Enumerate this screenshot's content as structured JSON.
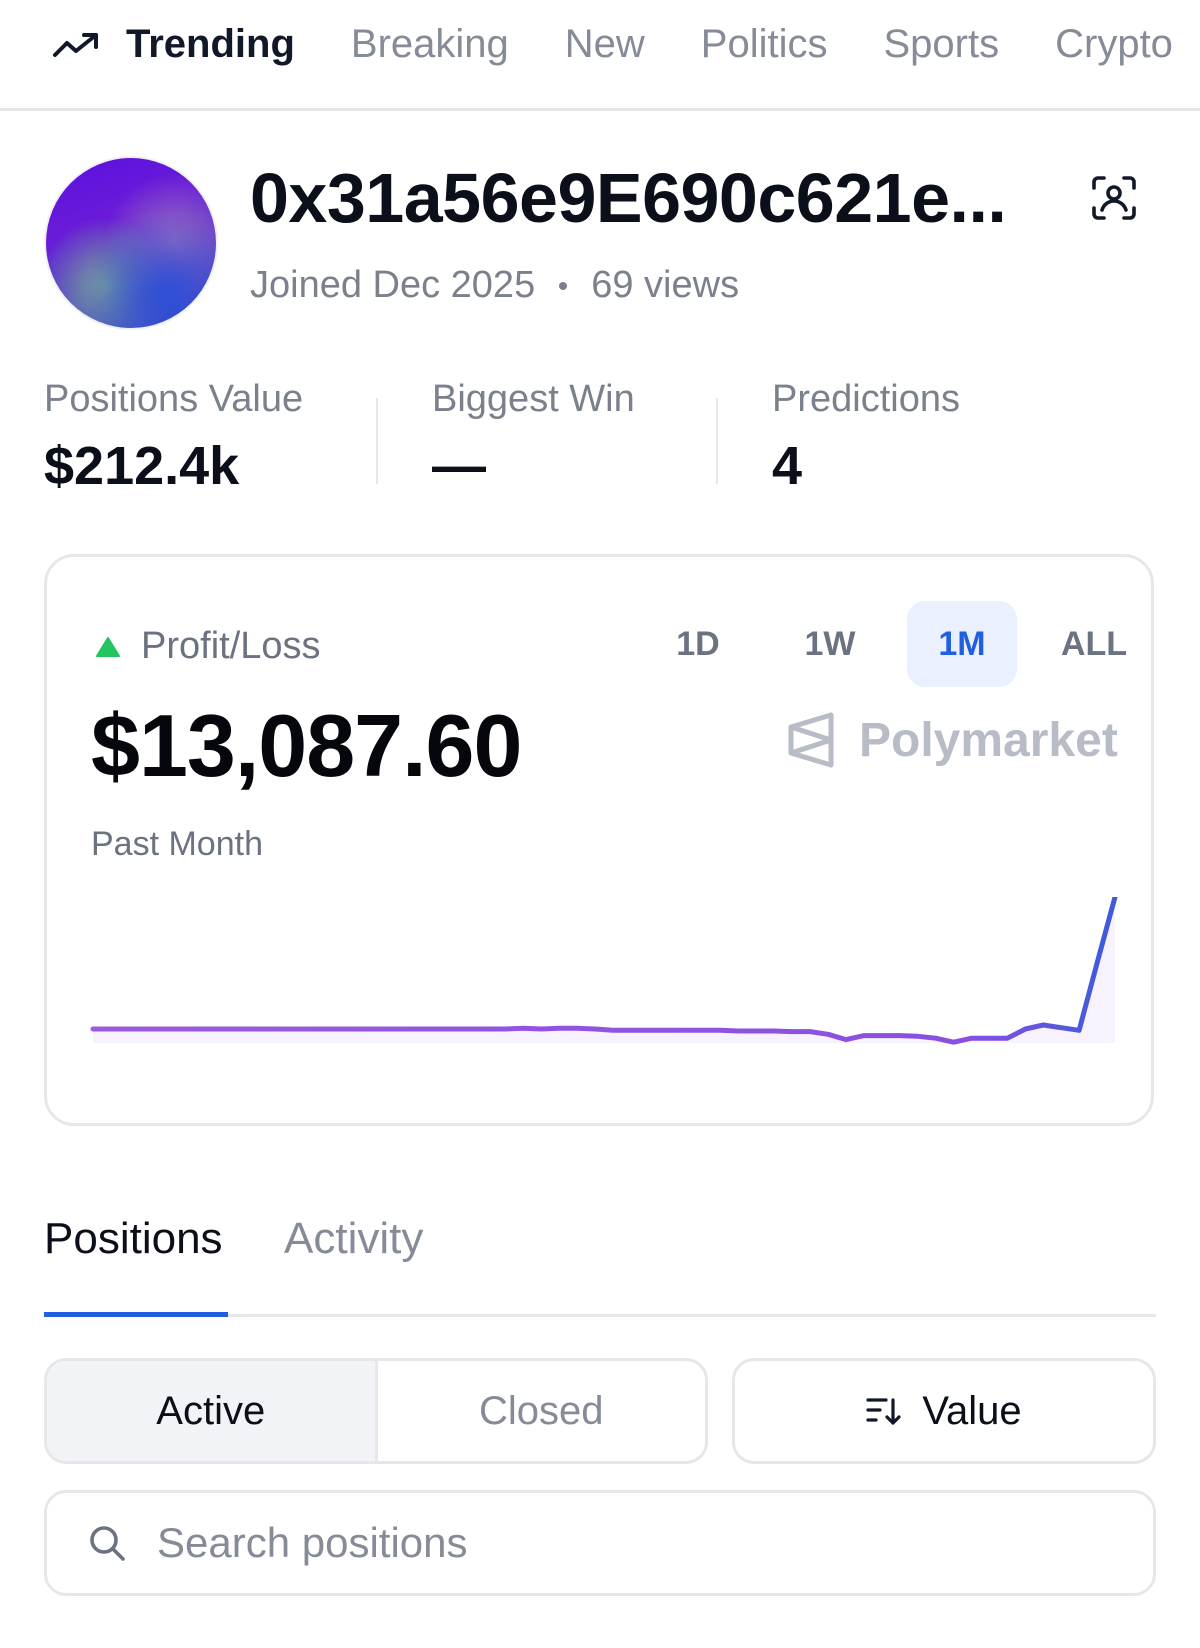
{
  "nav": {
    "items": [
      {
        "label": "Trending",
        "active": true
      },
      {
        "label": "Breaking",
        "active": false
      },
      {
        "label": "New",
        "active": false
      },
      {
        "label": "Politics",
        "active": false
      },
      {
        "label": "Sports",
        "active": false
      },
      {
        "label": "Crypto",
        "active": false
      }
    ]
  },
  "profile": {
    "username": "0x31a56e9E690c621e...",
    "joined": "Joined Dec 2025",
    "views": "69 views"
  },
  "stats": [
    {
      "label": "Positions Value",
      "value": "$212.4k"
    },
    {
      "label": "Biggest Win",
      "value": "—"
    },
    {
      "label": "Predictions",
      "value": "4"
    }
  ],
  "pnl": {
    "label": "Profit/Loss",
    "amount": "$13,087.60",
    "period": "Past Month",
    "brand": "Polymarket",
    "ranges": [
      {
        "label": "1D",
        "active": false
      },
      {
        "label": "1W",
        "active": false
      },
      {
        "label": "1M",
        "active": true
      },
      {
        "label": "ALL",
        "active": false
      }
    ]
  },
  "colors": {
    "accent": "#1f5fe0",
    "positive": "#22c55e",
    "line_start": "#9b5ae0",
    "line_end": "#3b5bdb"
  },
  "chart_data": {
    "type": "line",
    "series": [
      {
        "values": [
          0,
          0,
          0,
          0,
          0,
          0,
          0,
          0,
          0,
          0,
          0,
          0,
          0,
          0,
          0,
          0,
          0,
          0,
          0,
          0,
          0,
          0,
          0,
          0,
          0.5,
          0,
          0.5,
          0.5,
          0,
          -1,
          -1,
          -1,
          -1,
          -1,
          -1,
          -1,
          -1.5,
          -1.5,
          -1.5,
          -2,
          -2,
          -4,
          -8,
          -5,
          -5,
          -5,
          -5.5,
          -7,
          -10,
          -7,
          -7,
          -7,
          0,
          3,
          1,
          -1,
          50,
          100
        ]
      }
    ],
    "icons": {
      "trend": "trending-up-icon",
      "scan": "scan-face-icon",
      "sort": "sort-descending-icon",
      "search": "search-icon",
      "brand": "polymarket-logo-icon"
    }
  },
  "tabs": [
    {
      "label": "Positions",
      "active": true
    },
    {
      "label": "Activity",
      "active": false
    }
  ],
  "filters": {
    "active_label": "Active",
    "closed_label": "Closed",
    "sort_label": "Value"
  },
  "search": {
    "placeholder": "Search positions",
    "value": ""
  }
}
